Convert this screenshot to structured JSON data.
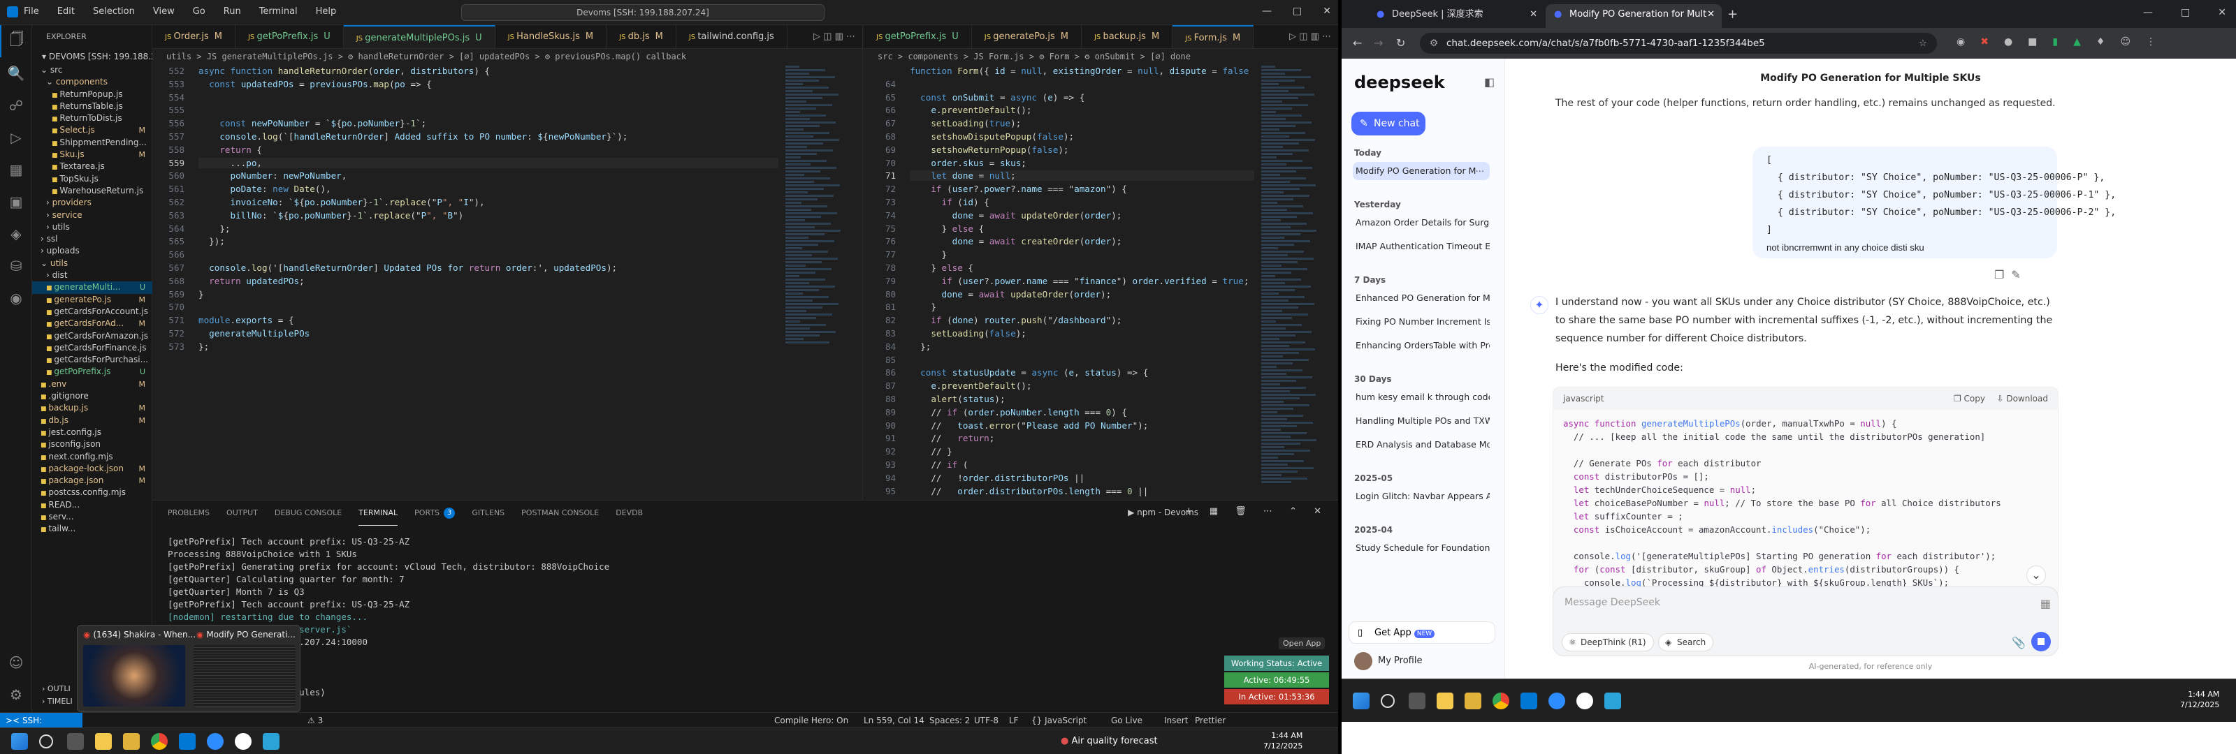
{
  "vscode": {
    "menu": [
      "File",
      "Edit",
      "Selection",
      "View",
      "Go",
      "Run",
      "Terminal",
      "Help"
    ],
    "command_center": "Devoms [SSH: 199.188.207.24]",
    "explorer_title": "EXPLORER",
    "workspace": "DEVOMS [SSH: 199.188.20...",
    "tree": [
      {
        "name": "src",
        "state": "",
        "depth": 1,
        "kind": "folder-open",
        "color": "#ccc"
      },
      {
        "name": "components",
        "state": "",
        "depth": 2,
        "kind": "folder-open",
        "color": "#e2c08d"
      },
      {
        "name": "ReturnPopup.js",
        "state": "",
        "depth": 3,
        "kind": "file",
        "color": "#ccc"
      },
      {
        "name": "ReturnsTable.js",
        "state": "",
        "depth": 3,
        "kind": "file",
        "color": "#ccc"
      },
      {
        "name": "ReturnToDist.js",
        "state": "",
        "depth": 3,
        "kind": "file",
        "color": "#ccc"
      },
      {
        "name": "Select.js",
        "state": "M",
        "depth": 3,
        "kind": "file",
        "color": "#e2c08d"
      },
      {
        "name": "ShippmentPending...",
        "state": "",
        "depth": 3,
        "kind": "file",
        "color": "#ccc"
      },
      {
        "name": "Sku.js",
        "state": "M",
        "depth": 3,
        "kind": "file",
        "color": "#e2c08d"
      },
      {
        "name": "Textarea.js",
        "state": "",
        "depth": 3,
        "kind": "file",
        "color": "#ccc"
      },
      {
        "name": "TopSku.js",
        "state": "",
        "depth": 3,
        "kind": "file",
        "color": "#ccc"
      },
      {
        "name": "WarehouseReturn.js",
        "state": "",
        "depth": 3,
        "kind": "file",
        "color": "#ccc"
      },
      {
        "name": "providers",
        "state": "",
        "depth": 2,
        "kind": "folder",
        "color": "#e2c08d"
      },
      {
        "name": "service",
        "state": "",
        "depth": 2,
        "kind": "folder",
        "color": "#e2c08d"
      },
      {
        "name": "utils",
        "state": "",
        "depth": 2,
        "kind": "folder",
        "color": "#ccc"
      },
      {
        "name": "ssl",
        "state": "",
        "depth": 1,
        "kind": "folder",
        "color": "#ccc"
      },
      {
        "name": "uploads",
        "state": "",
        "depth": 1,
        "kind": "folder",
        "color": "#ccc"
      },
      {
        "name": "utils",
        "state": "",
        "depth": 1,
        "kind": "folder-open",
        "color": "#e2c08d"
      },
      {
        "name": "dist",
        "state": "",
        "depth": 2,
        "kind": "folder",
        "color": "#ccc"
      },
      {
        "name": "generateMulti...",
        "state": "U",
        "depth": 2,
        "kind": "file",
        "color": "#73c991",
        "selected": true
      },
      {
        "name": "generatePo.js",
        "state": "M",
        "depth": 2,
        "kind": "file",
        "color": "#e2c08d"
      },
      {
        "name": "getCardsForAccount.js",
        "state": "",
        "depth": 2,
        "kind": "file",
        "color": "#ccc"
      },
      {
        "name": "getCardsForAd...",
        "state": "M",
        "depth": 2,
        "kind": "file",
        "color": "#e2c08d"
      },
      {
        "name": "getCardsForAmazon.js",
        "state": "",
        "depth": 2,
        "kind": "file",
        "color": "#ccc"
      },
      {
        "name": "getCardsForFinance.js",
        "state": "",
        "depth": 2,
        "kind": "file",
        "color": "#ccc"
      },
      {
        "name": "getCardsForPurchasi...",
        "state": "",
        "depth": 2,
        "kind": "file",
        "color": "#ccc"
      },
      {
        "name": "getPoPrefix.js",
        "state": "U",
        "depth": 2,
        "kind": "file",
        "color": "#73c991"
      },
      {
        "name": ".env",
        "state": "M",
        "depth": 1,
        "kind": "file",
        "color": "#e2c08d"
      },
      {
        "name": ".gitignore",
        "state": "",
        "depth": 1,
        "kind": "file",
        "color": "#ccc"
      },
      {
        "name": "backup.js",
        "state": "M",
        "depth": 1,
        "kind": "file",
        "color": "#e2c08d"
      },
      {
        "name": "db.js",
        "state": "M",
        "depth": 1,
        "kind": "file",
        "color": "#e2c08d"
      },
      {
        "name": "jest.config.js",
        "state": "",
        "depth": 1,
        "kind": "file",
        "color": "#ccc"
      },
      {
        "name": "jsconfig.json",
        "state": "",
        "depth": 1,
        "kind": "file",
        "color": "#ccc"
      },
      {
        "name": "next.config.mjs",
        "state": "",
        "depth": 1,
        "kind": "file",
        "color": "#ccc"
      },
      {
        "name": "package-lock.json",
        "state": "M",
        "depth": 1,
        "kind": "file",
        "color": "#e2c08d"
      },
      {
        "name": "package.json",
        "state": "M",
        "depth": 1,
        "kind": "file",
        "color": "#e2c08d"
      },
      {
        "name": "postcss.config.mjs",
        "state": "",
        "depth": 1,
        "kind": "file",
        "color": "#ccc"
      },
      {
        "name": "READ...",
        "state": "",
        "depth": 1,
        "kind": "file",
        "color": "#ccc"
      },
      {
        "name": "serv...",
        "state": "",
        "depth": 1,
        "kind": "file",
        "color": "#ccc"
      },
      {
        "name": "tailw...",
        "state": "",
        "depth": 1,
        "kind": "file",
        "color": "#ccc"
      }
    ],
    "outline": "OUTLI",
    "timeline": "TIMELI",
    "editorA": {
      "tabs": [
        {
          "label": "Order.js",
          "state": "M",
          "active": false
        },
        {
          "label": "getPoPrefix.js",
          "state": "U",
          "active": false
        },
        {
          "label": "generateMultiplePOs.js",
          "state": "U",
          "active": true
        },
        {
          "label": "HandleSkus.js",
          "state": "M",
          "active": false
        },
        {
          "label": "db.js",
          "state": "M",
          "active": false
        },
        {
          "label": "tailwind.config.js",
          "state": "",
          "active": false
        }
      ],
      "breadcrumb": "utils > JS generateMultiplePOs.js > ⚙ handleReturnOrder > [∅] updatedPOs > ⚙ previousPOs.map() callback",
      "lines": [
        {
          "n": "552",
          "t": "async function handleReturnOrder(order, distributors) {"
        },
        {
          "n": "553",
          "t": "  const updatedPOs = previousPOs.map(po => {"
        },
        {
          "n": "554",
          "t": ""
        },
        {
          "n": "555",
          "t": ""
        },
        {
          "n": "556",
          "t": "    const newPoNumber = `${po.poNumber}-1`;"
        },
        {
          "n": "557",
          "t": "    console.log(`[handleReturnOrder] Added suffix to PO number: ${newPoNumber}`);"
        },
        {
          "n": "558",
          "t": "    return {"
        },
        {
          "n": "559",
          "t": "      ...po,"
        },
        {
          "n": "560",
          "t": "      poNumber: newPoNumber,"
        },
        {
          "n": "561",
          "t": "      poDate: new Date(),"
        },
        {
          "n": "562",
          "t": "      invoiceNo: `${po.poNumber}-1`.replace(\"P\", \"I\"),"
        },
        {
          "n": "563",
          "t": "      billNo: `${po.poNumber}-1`.replace(\"P\", \"B\")"
        },
        {
          "n": "564",
          "t": "    };"
        },
        {
          "n": "565",
          "t": "  });"
        },
        {
          "n": "566",
          "t": ""
        },
        {
          "n": "567",
          "t": "  console.log('[handleReturnOrder] Updated POs for return order:', updatedPOs);"
        },
        {
          "n": "568",
          "t": "  return updatedPOs;"
        },
        {
          "n": "569",
          "t": "}"
        },
        {
          "n": "570",
          "t": ""
        },
        {
          "n": "571",
          "t": "module.exports = {"
        },
        {
          "n": "572",
          "t": "  generateMultiplePOs"
        },
        {
          "n": "573",
          "t": "};"
        }
      ]
    },
    "editorB": {
      "tabs": [
        {
          "label": "getPoPrefix.js",
          "state": "U",
          "active": false
        },
        {
          "label": "generatePo.js",
          "state": "M",
          "active": false
        },
        {
          "label": "backup.js",
          "state": "M",
          "active": false
        },
        {
          "label": "Form.js",
          "state": "M",
          "active": true
        }
      ],
      "breadcrumb": "src > components > JS Form.js > ⚙ Form > ⚙ onSubmit > [∅] done",
      "sticky": "function Form({ id = null, existingOrder = null, dispute = false })",
      "lines": [
        {
          "n": "64",
          "t": ""
        },
        {
          "n": "65",
          "t": "  const onSubmit = async (e) => {"
        },
        {
          "n": "66",
          "t": "    e.preventDefault();"
        },
        {
          "n": "67",
          "t": "    setLoading(true);"
        },
        {
          "n": "68",
          "t": "    setshowDisputePopup(false);"
        },
        {
          "n": "69",
          "t": "    setshowReturnPopup(false);"
        },
        {
          "n": "70",
          "t": "    order.skus = skus;"
        },
        {
          "n": "71",
          "t": "    let done = null;"
        },
        {
          "n": "72",
          "t": "    if (user?.power?.name === \"amazon\") {"
        },
        {
          "n": "73",
          "t": "      if (id) {"
        },
        {
          "n": "74",
          "t": "        done = await updateOrder(order);"
        },
        {
          "n": "75",
          "t": "      } else {"
        },
        {
          "n": "76",
          "t": "        done = await createOrder(order);"
        },
        {
          "n": "77",
          "t": "      }"
        },
        {
          "n": "78",
          "t": "    } else {"
        },
        {
          "n": "79",
          "t": "      if (user?.power.name === \"finance\") order.verified = true;"
        },
        {
          "n": "80",
          "t": "      done = await updateOrder(order);"
        },
        {
          "n": "81",
          "t": "    }"
        },
        {
          "n": "82",
          "t": "    if (done) router.push(\"/dashboard\");"
        },
        {
          "n": "83",
          "t": "    setLoading(false);"
        },
        {
          "n": "84",
          "t": "  };"
        },
        {
          "n": "85",
          "t": ""
        },
        {
          "n": "86",
          "t": "  const statusUpdate = async (e, status) => {"
        },
        {
          "n": "87",
          "t": "    e.preventDefault();"
        },
        {
          "n": "88",
          "t": "    alert(status);"
        },
        {
          "n": "89",
          "t": "    // if (order.poNumber.length === 0) {"
        },
        {
          "n": "90",
          "t": "    //   toast.error(\"Please add PO Number\");"
        },
        {
          "n": "91",
          "t": "    //   return;"
        },
        {
          "n": "92",
          "t": "    // }"
        },
        {
          "n": "93",
          "t": "    // if ("
        },
        {
          "n": "94",
          "t": "    //   !order.distributorPOs ||"
        },
        {
          "n": "95",
          "t": "    //   order.distributorPOs.length === 0 ||"
        }
      ]
    },
    "panel_tabs": [
      "PROBLEMS",
      "OUTPUT",
      "DEBUG CONSOLE",
      "TERMINAL",
      "PORTS",
      "GITLENS",
      "POSTMAN CONSOLE",
      "DEVDB"
    ],
    "ports_count": "3",
    "terminal_label": "npm - Devoms",
    "terminal_lines": [
      "[getPoPrefix] Tech account prefix: US-Q3-25-AZ",
      "Processing 888VoipChoice with 1 SKUs",
      "[getPoPrefix] Generating prefix for account: vCloud Tech, distributor: 888VoipChoice",
      "[getQuarter] Calculating quarter for month: 7",
      "[getQuarter] Month 7 is Q3",
      "[getPoPrefix] Tech account prefix: US-Q3-25-AZ",
      "[nodemon] restarting due to changes...",
      "[nodemon] starting `node server.js`",
      "> Ready on http://199.188.207.24:10000",
      "",
      "",
      "",
      "             .1s (705 modules)",
      "             odules)"
    ],
    "open_app": "Open App",
    "working_status": "Working Status: Active",
    "active_time": "Active: 06:49:55",
    "inactive_time": "In Active: 01:53:36",
    "thumb1_title": "(1634) Shakira - When...",
    "thumb2_title": "Modify PO Generati...",
    "status": {
      "remote": "SSH: 199.188.2",
      "errors": "3",
      "compile": "Compile Hero: On",
      "position": "Ln 559, Col 14",
      "spaces": "Spaces: 2",
      "encoding": "UTF-8",
      "eol": "LF",
      "language": "{} JavaScript",
      "golive": "Go Live",
      "insert": "Insert",
      "prettier": "Prettier"
    },
    "taskbar_weather": "Air quality forecast",
    "clock_time": "1:44 AM",
    "clock_date": "7/12/2025"
  },
  "chrome": {
    "tabs": [
      {
        "label": "DeepSeek | 深度求索",
        "active": false
      },
      {
        "label": "Modify PO Generation for Mult",
        "active": true
      }
    ],
    "url": "chat.deepseek.com/a/chat/s/a7fb0fb-5771-4730-aaf1-1235f344be5"
  },
  "deepseek": {
    "logo": "deepseek",
    "new_chat": "New chat",
    "groups": [
      {
        "title": "Today",
        "items": [
          "Modify PO Generation for M"
        ]
      },
      {
        "title": "Yesterday",
        "items": [
          "Amazon Order Details for Surge",
          "IMAP Authentication Timeout Er"
        ]
      },
      {
        "title": "7 Days",
        "items": [
          "Enhanced PO Generation for Mu",
          "Fixing PO Number Increment Iss",
          "Enhancing OrdersTable with Prof"
        ]
      },
      {
        "title": "30 Days",
        "items": [
          "hum kesy email k through code",
          "Handling Multiple POs and TXW",
          "ERD Analysis and Database Mod"
        ]
      },
      {
        "title": "2025-05",
        "items": [
          "Login Glitch: Navbar Appears Af"
        ]
      },
      {
        "title": "2025-04",
        "items": [
          "Study Schedule for Foundation L"
        ]
      }
    ],
    "get_app": "Get App",
    "get_app_badge": "NEW",
    "profile": "My Profile",
    "chat_title": "Modify PO Generation for Multiple SKUs",
    "prev_text": "The rest of your code (helper functions, return order handling, etc.) remains unchanged as requested.",
    "user_msg": [
      "[",
      "  { distributor: \"SY Choice\", poNumber: \"US-Q3-25-00006-P\" },",
      "  { distributor: \"SY Choice\", poNumber: \"US-Q3-25-00006-P-1\" },",
      "  { distributor: \"SY Choice\", poNumber: \"US-Q3-25-00006-P-2\" },",
      "]",
      "not ibncrremwnt in any choice disti sku"
    ],
    "answer_p1": "I understand now - you want all SKUs under any Choice distributor (SY Choice, 888VoipChoice, etc.) to share the same base PO number with incremental suffixes (-1, -2, etc.), without incrementing the sequence number for different Choice distributors.",
    "answer_p2": "Here's the modified code:",
    "code_lang": "javascript",
    "copy": "Copy",
    "download": "Download",
    "code_lines": [
      "async function generateMultiplePOs(order, manualTxwhPo = null) {",
      "  // ... [keep all the initial code the same until the distributorPOs generation]",
      "",
      "  // Generate POs for each distributor",
      "  const distributorPOs = [];",
      "  let techUnderChoiceSequence = null;",
      "  let choiceBasePoNumber = null; // To store the base PO for all Choice distributors",
      "  let suffixCounter = 0;",
      "  const isChoiceAccount = amazonAccount.includes(\"Choice\");",
      "",
      "  console.log('[generateMultiplePOs] Starting PO generation for each distributor');",
      "  for (const [distributor, skuGroup] of Object.entries(distributorGroups)) {",
      "    console.log(`Processing ${distributor} with ${skuGroup.length} SKUs`);"
    ],
    "input_placeholder": "Message DeepSeek",
    "deepthink": "DeepThink (R1)",
    "search": "Search",
    "footer": "AI-generated, for reference only"
  },
  "taskbar2": {
    "time": "1:44 AM",
    "date": "7/12/2025"
  }
}
